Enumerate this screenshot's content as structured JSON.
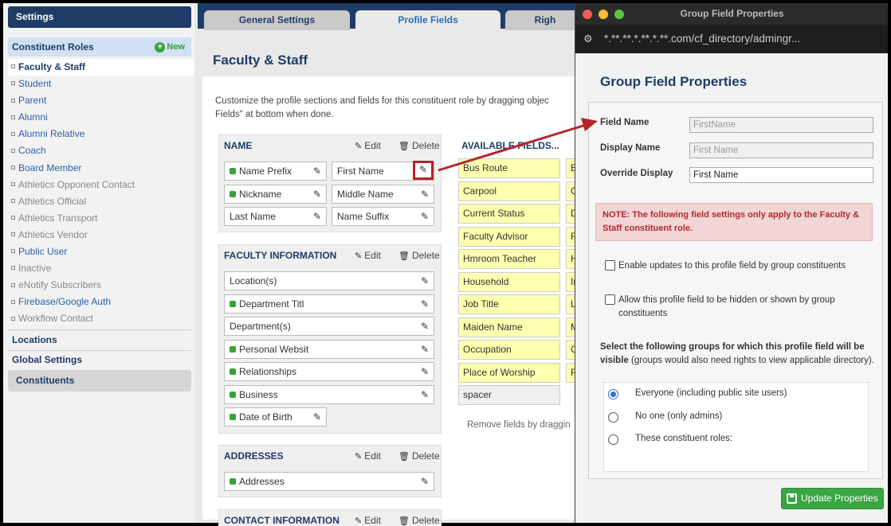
{
  "sidebar": {
    "title": "Settings",
    "roles_header": "Constituent Roles",
    "new_label": "New",
    "roles": [
      {
        "label": "Faculty & Staff",
        "state": "active"
      },
      {
        "label": "Student",
        "state": "normal"
      },
      {
        "label": "Parent",
        "state": "normal"
      },
      {
        "label": "Alumni",
        "state": "normal"
      },
      {
        "label": "Alumni Relative",
        "state": "normal"
      },
      {
        "label": "Coach",
        "state": "normal"
      },
      {
        "label": "Board Member",
        "state": "normal"
      },
      {
        "label": "Athletics Opponent Contact",
        "state": "inactive"
      },
      {
        "label": "Athletics Official",
        "state": "inactive"
      },
      {
        "label": "Athletics Transport",
        "state": "inactive"
      },
      {
        "label": "Athletics Vendor",
        "state": "inactive"
      },
      {
        "label": "Public User",
        "state": "normal"
      },
      {
        "label": "Inactive",
        "state": "inactive"
      },
      {
        "label": "eNotify Subscribers",
        "state": "inactive"
      },
      {
        "label": "Firebase/Google Auth",
        "state": "normal"
      },
      {
        "label": "Workflow Contact",
        "state": "inactive"
      }
    ],
    "locations": "Locations",
    "global_settings": "Global Settings",
    "constituents": "Constituents"
  },
  "tabs": {
    "general": "General Settings",
    "profile": "Profile Fields",
    "rights": "Righ"
  },
  "page": {
    "title": "Faculty & Staff",
    "intro": "Customize the profile sections and fields for this constituent role by dragging objec Fields\" at bottom when done."
  },
  "sections": {
    "edit_label": "Edit",
    "delete_label": "Delete",
    "name": {
      "title": "NAME",
      "fields": [
        "Name Prefix",
        "First Name",
        "Nickname",
        "Middle Name",
        "Last Name",
        "Name Suffix"
      ]
    },
    "faculty": {
      "title": "FACULTY INFORMATION",
      "fields": [
        "Location(s)",
        "Department Titl",
        "Department(s)",
        "Personal Websit",
        "Relationships",
        "Business",
        "Date of Birth"
      ]
    },
    "addresses": {
      "title": "ADDRESSES",
      "fields": [
        "Addresses"
      ]
    },
    "contact": {
      "title": "CONTACT INFORMATION"
    }
  },
  "available": {
    "title": "AVAILABLE FIELDS...",
    "fields": [
      "Bus Route",
      "Carpool",
      "Current Status",
      "Faculty Advisor",
      "Hmroom Teacher",
      "Household",
      "Job Title",
      "Maiden Name",
      "Occupation",
      "Place of Worship",
      "spacer"
    ],
    "col2_letters": [
      "B",
      "C",
      "D",
      "F",
      "H",
      "In",
      "L",
      "M",
      "O",
      "R"
    ],
    "remove_note": "Remove fields by draggin"
  },
  "popup": {
    "window_title": "Group Field Properties",
    "url": "*.**.**.*.**.*.**.com/cf_directory/admingr...",
    "heading": "Group Field Properties",
    "field_name_label": "Field Name",
    "field_name_value": "FirstName",
    "display_name_label": "Display Name",
    "display_name_value": "First Name",
    "override_label": "Override Display",
    "override_value": "First Name",
    "note": "NOTE: The following field settings only apply to the Faculty & Staff constituent role.",
    "enable_updates": "Enable updates to this profile field by group constituents",
    "allow_hidden": "Allow this profile field to be hidden or shown by group constituents",
    "visibility_bold": "Select the following groups for which this profile field will be visible",
    "visibility_rest": " (groups would also need rights to view applicable directory).",
    "radio_everyone": "Everyone (including public site users)",
    "radio_noone": "No one (only admins)",
    "radio_roles": "These constituent roles:",
    "update_button": "Update Properties"
  },
  "colors": {
    "navy": "#1f3c67",
    "link": "#2a5fa8",
    "green": "#3aa545",
    "highlight_red": "#b5262a",
    "yellow_field": "#ffffb0"
  }
}
